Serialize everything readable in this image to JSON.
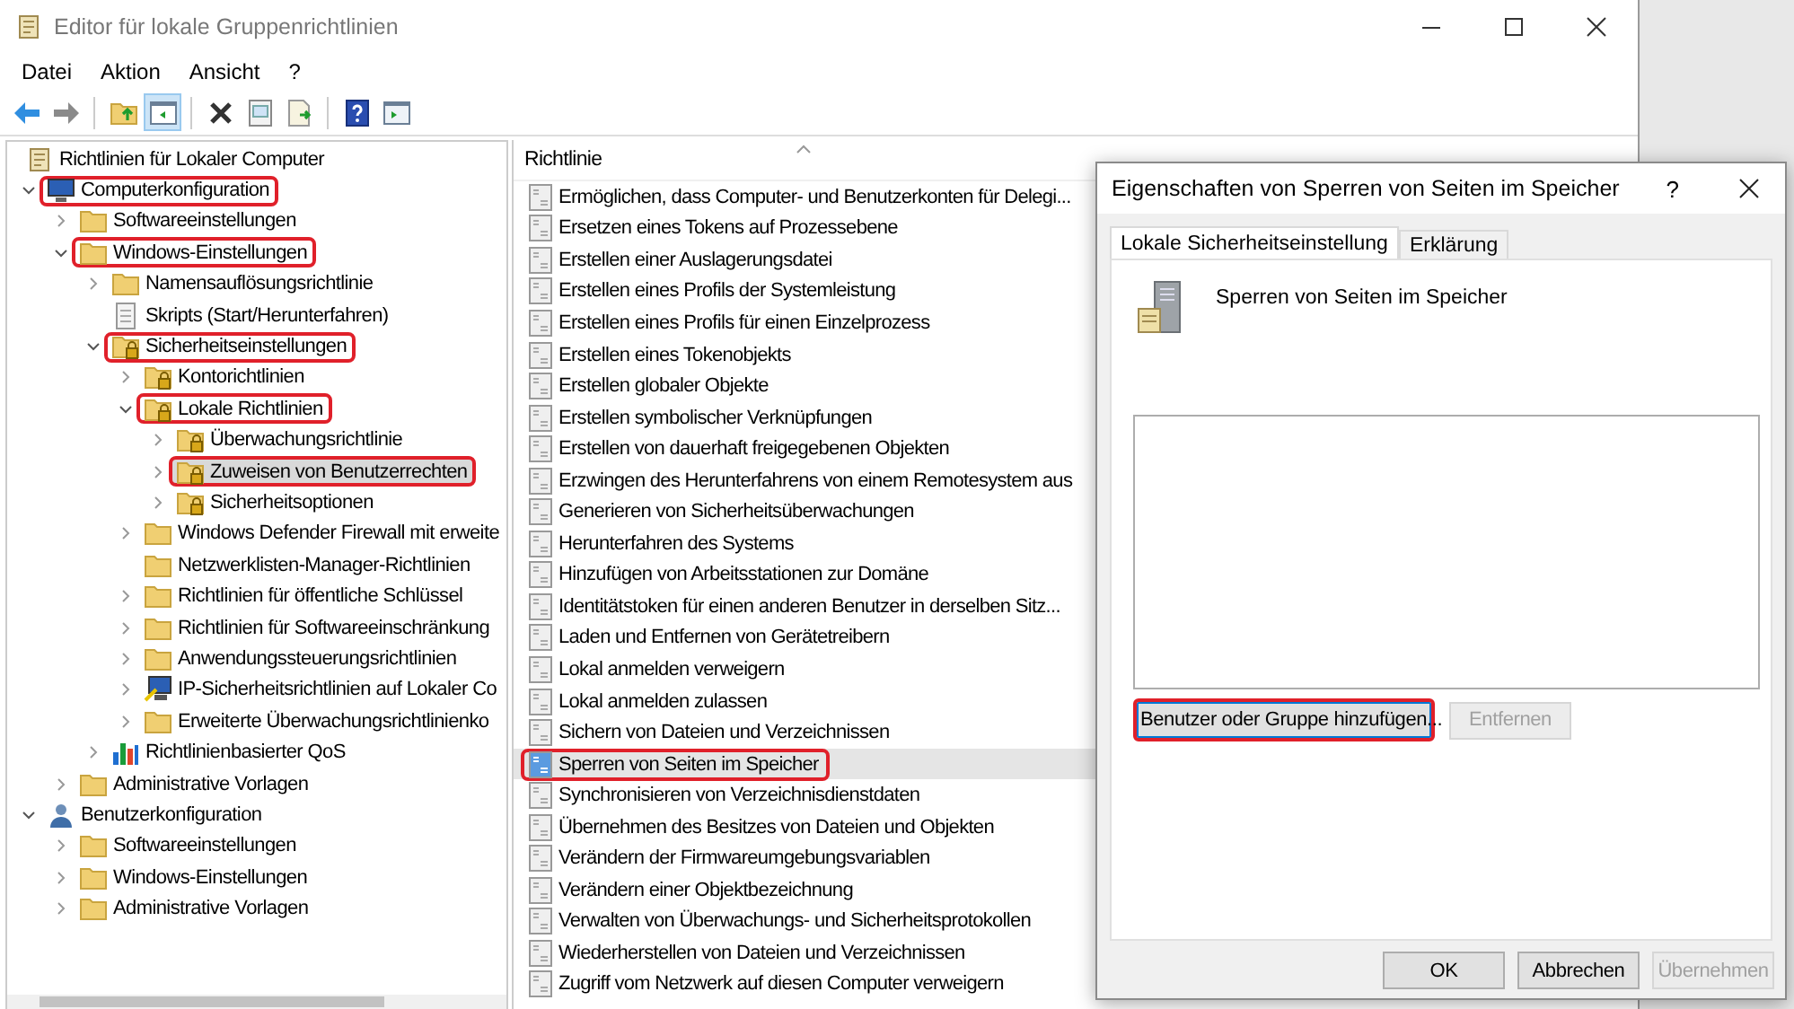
{
  "window": {
    "title": "Editor für lokale Gruppenrichtlinien"
  },
  "menu": [
    "Datei",
    "Aktion",
    "Ansicht",
    "?"
  ],
  "toolbar": [
    [
      {
        "kind": "back"
      },
      {
        "kind": "forward"
      }
    ],
    [
      {
        "kind": "up"
      },
      {
        "kind": "tree",
        "pressed": true
      }
    ],
    [
      {
        "kind": "delete"
      },
      {
        "kind": "properties"
      },
      {
        "kind": "export"
      }
    ],
    [
      {
        "kind": "help"
      },
      {
        "kind": "console"
      }
    ]
  ],
  "tree": [
    {
      "label": "Richtlinien für Lokaler Computer",
      "kind": "scroll",
      "selected": false,
      "highlighted": false,
      "children": [
        {
          "label": "Computerkonfiguration",
          "kind": "computer",
          "expanded": true,
          "selected": false,
          "highlighted": true,
          "children": [
            {
              "label": "Softwareeinstellungen",
              "kind": "folder",
              "expanded": false,
              "selected": false,
              "highlighted": false
            },
            {
              "label": "Windows-Einstellungen",
              "kind": "folder",
              "expanded": true,
              "selected": false,
              "highlighted": true,
              "children": [
                {
                  "label": "Namensauflösungsrichtlinie",
                  "kind": "folder",
                  "expanded": false,
                  "selected": false,
                  "highlighted": false
                },
                {
                  "label": "Skripts (Start/Herunterfahren)",
                  "kind": "script",
                  "selected": false,
                  "highlighted": false
                },
                {
                  "label": "Sicherheitseinstellungen",
                  "kind": "secure",
                  "expanded": true,
                  "selected": false,
                  "highlighted": true,
                  "children": [
                    {
                      "label": "Kontorichtlinien",
                      "kind": "secure",
                      "expanded": false,
                      "selected": false,
                      "highlighted": false
                    },
                    {
                      "label": "Lokale Richtlinien",
                      "kind": "secure",
                      "expanded": true,
                      "selected": false,
                      "highlighted": true,
                      "children": [
                        {
                          "label": "Überwachungsrichtlinie",
                          "kind": "secure",
                          "expanded": false,
                          "selected": false,
                          "highlighted": false
                        },
                        {
                          "label": "Zuweisen von Benutzerrechten",
                          "kind": "secure",
                          "expanded": false,
                          "selected": true,
                          "highlighted": true
                        },
                        {
                          "label": "Sicherheitsoptionen",
                          "kind": "secure",
                          "expanded": false,
                          "selected": false,
                          "highlighted": false
                        }
                      ]
                    },
                    {
                      "label": "Windows Defender Firewall mit erweite",
                      "kind": "folder",
                      "expanded": false,
                      "selected": false,
                      "highlighted": false
                    },
                    {
                      "label": "Netzwerklisten-Manager-Richtlinien",
                      "kind": "folder",
                      "selected": false,
                      "highlighted": false
                    },
                    {
                      "label": "Richtlinien für öffentliche Schlüssel",
                      "kind": "folder",
                      "expanded": false,
                      "selected": false,
                      "highlighted": false
                    },
                    {
                      "label": "Richtlinien für Softwareeinschränkung",
                      "kind": "folder",
                      "expanded": false,
                      "selected": false,
                      "highlighted": false
                    },
                    {
                      "label": "Anwendungssteuerungsrichtlinien",
                      "kind": "folder",
                      "expanded": false,
                      "selected": false,
                      "highlighted": false
                    },
                    {
                      "label": "IP-Sicherheitsrichtlinien auf Lokaler Co",
                      "kind": "network",
                      "expanded": false,
                      "selected": false,
                      "highlighted": false
                    },
                    {
                      "label": "Erweiterte Überwachungsrichtlinienko",
                      "kind": "folder",
                      "expanded": false,
                      "selected": false,
                      "highlighted": false
                    }
                  ]
                },
                {
                  "label": "Richtlinienbasierter QoS",
                  "kind": "chart",
                  "expanded": false,
                  "selected": false,
                  "highlighted": false
                }
              ]
            },
            {
              "label": "Administrative Vorlagen",
              "kind": "folder",
              "expanded": false,
              "selected": false,
              "highlighted": false
            }
          ]
        },
        {
          "label": "Benutzerkonfiguration",
          "kind": "user",
          "expanded": true,
          "selected": false,
          "highlighted": false,
          "children": [
            {
              "label": "Softwareeinstellungen",
              "kind": "folder",
              "expanded": false,
              "selected": false,
              "highlighted": false
            },
            {
              "label": "Windows-Einstellungen",
              "kind": "folder",
              "expanded": false,
              "selected": false,
              "highlighted": false
            },
            {
              "label": "Administrative Vorlagen",
              "kind": "folder",
              "expanded": false,
              "selected": false,
              "highlighted": false
            }
          ]
        }
      ]
    }
  ],
  "list": {
    "column": "Richtlinie",
    "items": [
      {
        "label": "Ermöglichen, dass Computer- und Benutzerkonten für Delegi...",
        "selected": false,
        "highlighted": false
      },
      {
        "label": "Ersetzen eines Tokens auf Prozessebene",
        "selected": false,
        "highlighted": false
      },
      {
        "label": "Erstellen einer Auslagerungsdatei",
        "selected": false,
        "highlighted": false
      },
      {
        "label": "Erstellen eines Profils der Systemleistung",
        "selected": false,
        "highlighted": false
      },
      {
        "label": "Erstellen eines Profils für einen Einzelprozess",
        "selected": false,
        "highlighted": false
      },
      {
        "label": "Erstellen eines Tokenobjekts",
        "selected": false,
        "highlighted": false
      },
      {
        "label": "Erstellen globaler Objekte",
        "selected": false,
        "highlighted": false
      },
      {
        "label": "Erstellen symbolischer Verknüpfungen",
        "selected": false,
        "highlighted": false
      },
      {
        "label": "Erstellen von dauerhaft freigegebenen Objekten",
        "selected": false,
        "highlighted": false
      },
      {
        "label": "Erzwingen des Herunterfahrens von einem Remotesystem aus",
        "selected": false,
        "highlighted": false
      },
      {
        "label": "Generieren von Sicherheitsüberwachungen",
        "selected": false,
        "highlighted": false
      },
      {
        "label": "Herunterfahren des Systems",
        "selected": false,
        "highlighted": false
      },
      {
        "label": "Hinzufügen von Arbeitsstationen zur Domäne",
        "selected": false,
        "highlighted": false
      },
      {
        "label": "Identitätstoken für einen anderen Benutzer in derselben Sitz...",
        "selected": false,
        "highlighted": false
      },
      {
        "label": "Laden und Entfernen von Gerätetreibern",
        "selected": false,
        "highlighted": false
      },
      {
        "label": "Lokal anmelden verweigern",
        "selected": false,
        "highlighted": false
      },
      {
        "label": "Lokal anmelden zulassen",
        "selected": false,
        "highlighted": false
      },
      {
        "label": "Sichern von Dateien und Verzeichnissen",
        "selected": false,
        "highlighted": false
      },
      {
        "label": "Sperren von Seiten im Speicher",
        "selected": true,
        "highlighted": true
      },
      {
        "label": "Synchronisieren von Verzeichnisdienstdaten",
        "selected": false,
        "highlighted": false
      },
      {
        "label": "Übernehmen des Besitzes von Dateien und Objekten",
        "selected": false,
        "highlighted": false
      },
      {
        "label": "Verändern der Firmwareumgebungsvariablen",
        "selected": false,
        "highlighted": false
      },
      {
        "label": "Verändern einer Objektbezeichnung",
        "selected": false,
        "highlighted": false
      },
      {
        "label": "Verwalten von Überwachungs- und Sicherheitsprotokollen",
        "selected": false,
        "highlighted": false
      },
      {
        "label": "Wiederherstellen von Dateien und Verzeichnissen",
        "selected": false,
        "highlighted": false
      },
      {
        "label": "Zugriff vom Netzwerk auf diesen Computer verweigern",
        "selected": false,
        "highlighted": false
      }
    ]
  },
  "dialog": {
    "title": "Eigenschaften von Sperren von Seiten im Speicher",
    "help": "?",
    "tabs": [
      {
        "label": "Lokale Sicherheitseinstellung",
        "selected": true
      },
      {
        "label": "Erklärung",
        "selected": false
      }
    ],
    "policy_name": "Sperren von Seiten im Speicher",
    "buttons": [
      {
        "label": "Benutzer oder Gruppe hinzufügen...",
        "disabled": false,
        "highlighted": true,
        "focused": true
      },
      {
        "label": "Entfernen",
        "disabled": true,
        "highlighted": false,
        "focused": false
      }
    ],
    "footer_buttons": [
      {
        "label": "OK",
        "disabled": false
      },
      {
        "label": "Abbrechen",
        "disabled": false
      },
      {
        "label": "Übernehmen",
        "disabled": true
      }
    ]
  }
}
